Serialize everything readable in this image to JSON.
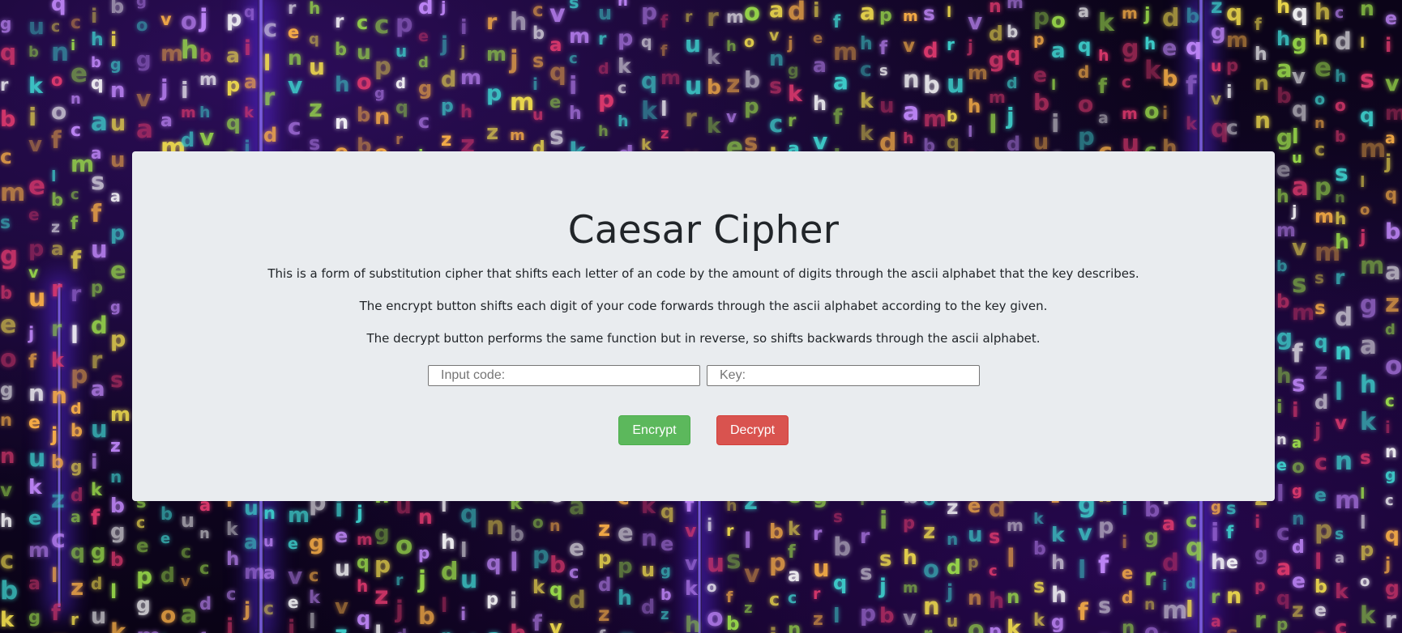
{
  "page": {
    "title": "Caesar Cipher",
    "description": "This is a form of substitution cipher that shifts each letter of an code by the amount of digits through the ascii alphabet that the key describes.",
    "encrypt_info": "The encrypt button shifts each digit of your code forwards through the ascii alphabet according to the key given.",
    "decrypt_info": "The decrypt button performs the same function but in reverse, so shifts backwards through the ascii alphabet."
  },
  "form": {
    "code_input": {
      "value": "",
      "placeholder": "Input code:"
    },
    "key_input": {
      "value": "",
      "placeholder": "Key:"
    },
    "encrypt_label": "Encrypt",
    "decrypt_label": "Decrypt"
  },
  "colors": {
    "card_background": "#e9ecef",
    "encrypt_button": "#5cb85c",
    "decrypt_button": "#d9534f",
    "text": "#212529"
  },
  "background": {
    "icon": "matrix-glyph-rain-image"
  }
}
